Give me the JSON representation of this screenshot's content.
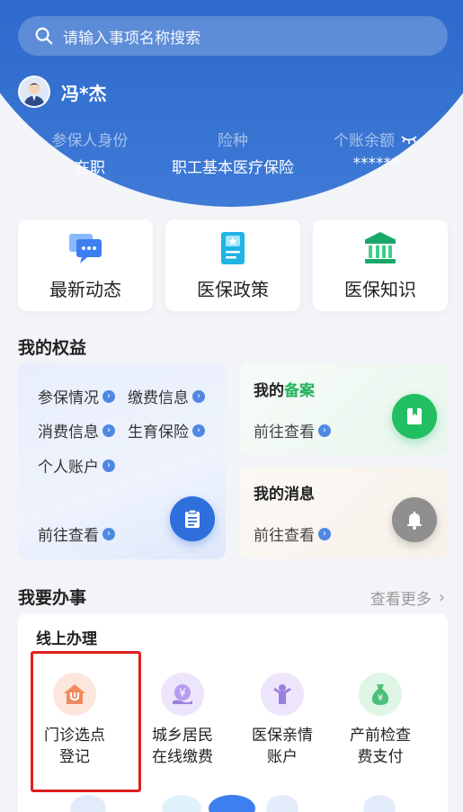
{
  "search": {
    "placeholder": "请输入事项名称搜索"
  },
  "user": {
    "name": "冯*杰"
  },
  "insurance_info": [
    {
      "label": "参保人身份",
      "value": "在职"
    },
    {
      "label": "险种",
      "value": "职工基本医疗保险"
    },
    {
      "label": "个账余额",
      "value": "******"
    }
  ],
  "quick_cards": [
    {
      "label": "最新动态",
      "icon": "chat-bubble-icon"
    },
    {
      "label": "医保政策",
      "icon": "policy-doc-icon"
    },
    {
      "label": "医保知识",
      "icon": "bank-building-icon"
    }
  ],
  "benefits": {
    "title": "我的权益",
    "items": [
      "参保情况",
      "缴费信息",
      "消费信息",
      "生育保险",
      "个人账户"
    ],
    "link": "前往查看",
    "filing": {
      "title_prefix": "我的",
      "title_highlight": "备案",
      "link": "前往查看"
    },
    "messages": {
      "title": "我的消息",
      "link": "前往查看"
    }
  },
  "tasks": {
    "title": "我要办事",
    "more": "查看更多",
    "online_title": "线上办理",
    "services": [
      {
        "line1": "门诊选点",
        "line2": "登记",
        "icon": "home-clinic-icon",
        "color": "#f08a5d"
      },
      {
        "line1": "城乡居民",
        "line2": "在线缴费",
        "icon": "yuan-coin-icon",
        "color": "#9b7fe0"
      },
      {
        "line1": "医保亲情",
        "line2": "账户",
        "icon": "family-person-icon",
        "color": "#9b7fe0"
      },
      {
        "line1": "产前检查",
        "line2": "费支付",
        "icon": "money-bag-icon",
        "color": "#4cbf7a"
      }
    ]
  },
  "colors": {
    "primary": "#2a66c9",
    "green": "#21b45c",
    "highlight_border": "#e02020"
  }
}
